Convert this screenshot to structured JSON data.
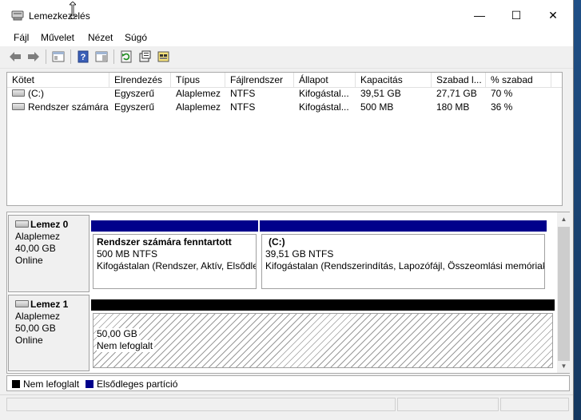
{
  "window": {
    "title": "Lemezkezelés"
  },
  "caption": {
    "minimize": "—",
    "maximize": "☐",
    "close": "✕"
  },
  "menu": [
    "Fájl",
    "Művelet",
    "Nézet",
    "Súgó"
  ],
  "toolbar": {
    "icons": [
      "back-arrow-icon",
      "forward-arrow-icon",
      "console-tree-icon",
      "help-icon",
      "show-pane-icon",
      "refresh-icon",
      "properties-icon",
      "wizard-icon"
    ]
  },
  "volume_list": {
    "columns": [
      "Kötet",
      "Elrendezés",
      "Típus",
      "Fájlrendszer",
      "Állapot",
      "Kapacitás",
      "Szabad l...",
      "% szabad"
    ],
    "rows": [
      [
        "(C:)",
        "Egyszerű",
        "Alaplemez",
        "NTFS",
        "Kifogástal...",
        "39,51 GB",
        "27,71 GB",
        "70 %"
      ],
      [
        "Rendszer számára ...",
        "Egyszerű",
        "Alaplemez",
        "NTFS",
        "Kifogástal...",
        "500 MB",
        "180 MB",
        "36 %"
      ]
    ]
  },
  "disks": [
    {
      "name": "Lemez 0",
      "type": "Alaplemez",
      "size": "40,00 GB",
      "status": "Online",
      "partitions": [
        {
          "name": "Rendszer számára fenntartott",
          "size": "500 MB NTFS",
          "status": "Kifogástalan (Rendszer, Aktív, Elsődleges partíció)"
        },
        {
          "name": "(C:)",
          "size": "39,51 GB NTFS",
          "status": "Kifogástalan (Rendszerindítás, Lapozófájl, Összeomlási memóriakép, Elsődleges partíció)"
        }
      ]
    },
    {
      "name": "Lemez 1",
      "type": "Alaplemez",
      "size": "50,00 GB",
      "status": "Online",
      "partitions": [
        {
          "size": "50,00 GB",
          "status": "Nem lefoglalt"
        }
      ]
    }
  ],
  "legend": [
    {
      "label": "Nem lefoglalt",
      "color": "#000000"
    },
    {
      "label": "Elsődleges partíció",
      "color": "#00008b"
    }
  ],
  "colors": {
    "primary_partition": "#00008b",
    "unallocated": "#000000"
  }
}
